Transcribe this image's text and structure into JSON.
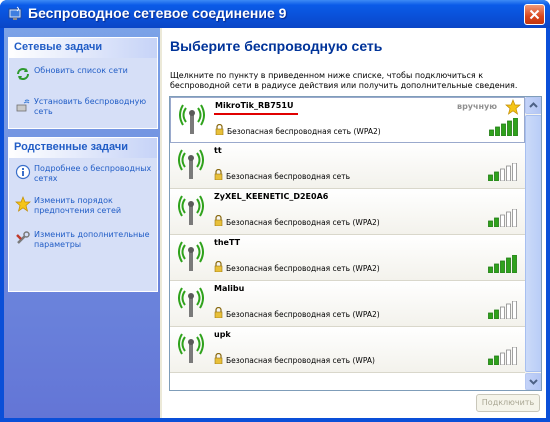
{
  "window": {
    "title": "Беспроводное сетевое соединение 9"
  },
  "sidebar": {
    "network_tasks": {
      "title": "Сетевые задачи",
      "items": [
        {
          "label": "Обновить список сети",
          "icon": "refresh-icon"
        },
        {
          "label": "Установить беспроводную сеть",
          "icon": "setup-network-icon"
        }
      ]
    },
    "related_tasks": {
      "title": "Родственные задачи",
      "items": [
        {
          "label": "Подробнее о беспроводных сетях",
          "icon": "info-icon"
        },
        {
          "label": "Изменить порядок предпочтения сетей",
          "icon": "star-icon"
        },
        {
          "label": "Изменить дополнительные параметры",
          "icon": "tools-icon"
        }
      ]
    }
  },
  "main": {
    "title": "Выберите беспроводную сеть",
    "description": "Щелкните по пункту в приведенном ниже списке, чтобы подключиться к беспроводной сети в радиусе действия или получить дополнительные сведения.",
    "connect_button": "Подключить"
  },
  "networks": [
    {
      "ssid": "MikroTik_RB751U",
      "security": "Безопасная беспроводная сеть (WPA2)",
      "signal_bars": 5,
      "manual": "вручную",
      "preferred": true
    },
    {
      "ssid": "tt",
      "security": "Безопасная беспроводная сеть",
      "signal_bars": 2
    },
    {
      "ssid": "ZyXEL_KEENETIC_D2E0A6",
      "security": "Безопасная беспроводная сеть (WPA2)",
      "signal_bars": 2
    },
    {
      "ssid": "theTT",
      "security": "Безопасная беспроводная сеть (WPA2)",
      "signal_bars": 5
    },
    {
      "ssid": "Malibu",
      "security": "Безопасная беспроводная сеть (WPA2)",
      "signal_bars": 2
    },
    {
      "ssid": "upk",
      "security": "Безопасная беспроводная сеть (WPA)",
      "signal_bars": 2
    }
  ],
  "colors": {
    "titlebar": "#0a50d8",
    "link": "#215dc6",
    "heading": "#003399",
    "signal_green": "#2fa21c",
    "highlight_underline": "#e00000"
  }
}
